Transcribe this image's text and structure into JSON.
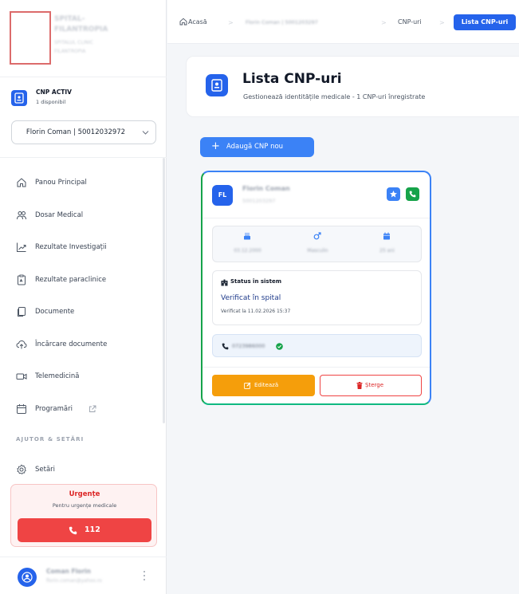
{
  "sidebar": {
    "hospital_name_line1": "SPITAL-",
    "hospital_name_line2": "FILANTROPIA",
    "hospital_sub_line1": "SPITALUL CLINIC",
    "hospital_sub_line2": "FILANTROPIA",
    "cnp_active_label": "CNP ACTIV",
    "cnp_available": "1 disponibil",
    "selected_patient": "Florin Coman | 50012032972",
    "nav": [
      {
        "label": "Panou Principal",
        "icon": "home-icon"
      },
      {
        "label": "Dosar Medical",
        "icon": "users-icon"
      },
      {
        "label": "Rezultate Investigații",
        "icon": "trending-chart-icon"
      },
      {
        "label": "Rezultate paraclinice",
        "icon": "lab-report-icon"
      },
      {
        "label": "Documente",
        "icon": "documents-icon"
      },
      {
        "label": "Încărcare documente",
        "icon": "cloud-upload-icon"
      },
      {
        "label": "Telemedicină",
        "icon": "video-icon"
      },
      {
        "label": "Programări",
        "icon": "calendar-icon"
      }
    ],
    "section_title": "AJUTOR & SETĂRI",
    "settings_label": "Setări",
    "urgent": {
      "title": "Urgențe",
      "subtitle": "Pentru urgențe medicale",
      "number": "112"
    },
    "user": {
      "name": "Coman Florin",
      "email": "florin.coman@yahoo.ro"
    }
  },
  "breadcrumb": {
    "home": "Acasă",
    "patient": "Florin Coman | 5001203297",
    "cnp_list": "CNP-uri",
    "current": "Lista CNP-uri"
  },
  "header": {
    "title": "Lista CNP-uri",
    "subtitle": "Gestionează identitățile medicale - 1 CNP-uri înregistrate"
  },
  "add_button_label": "Adaugă CNP nou",
  "card": {
    "initials": "FL",
    "name": "Florin Coman",
    "cnp": "5001203297",
    "birth_date": "03.12.2000",
    "gender": "Masculin",
    "age": "25 ani",
    "status_title": "Status în sistem",
    "status_value": "Verificat în spital",
    "status_date": "Verificat la 11.02.2026 15:37",
    "phone": "0723986000",
    "edit_label": "Editează",
    "delete_label": "Șterge"
  },
  "colors": {
    "primary": "#2563eb",
    "success": "#16a34a",
    "warning": "#f59e0b",
    "danger": "#ef4444"
  }
}
